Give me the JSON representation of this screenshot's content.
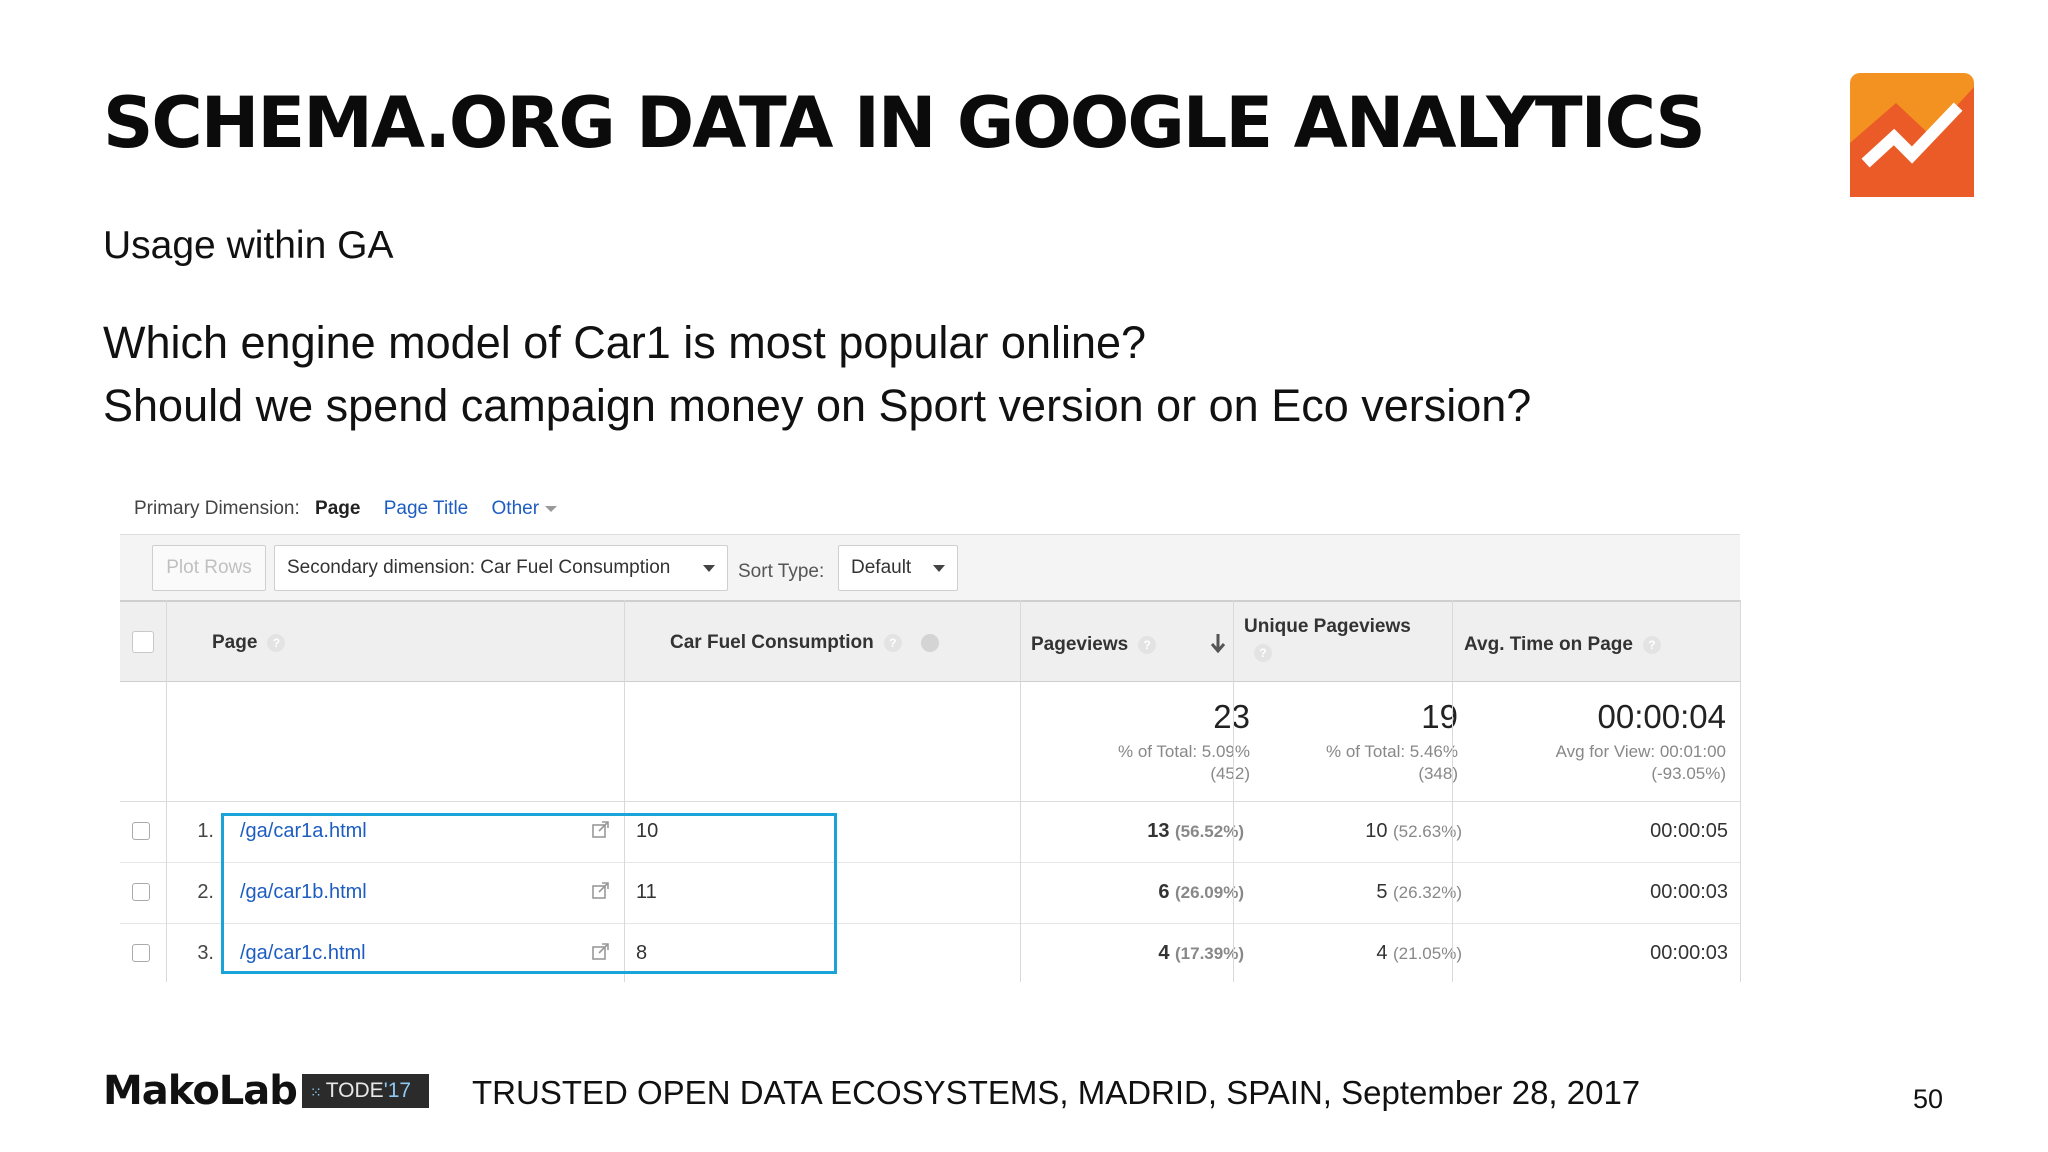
{
  "slide": {
    "title": "SCHEMA.ORG DATA IN GOOGLE ANALYTICS",
    "subtitle": "Usage within GA",
    "question_1": "Which engine model of Car1 is most popular online?",
    "question_2": "Should we spend campaign money on Sport version or on Eco version?",
    "colors": {
      "logo_orange": "#f39221",
      "logo_red": "#ea5b27",
      "highlight": "#1aa3d8",
      "link": "#1d5dc1"
    }
  },
  "ga": {
    "primary_dimension": {
      "label": "Primary Dimension:",
      "active": "Page",
      "options": [
        "Page Title",
        "Other"
      ]
    },
    "toolbar": {
      "plot_rows": "Plot Rows",
      "secondary_dimension": "Secondary dimension: Car Fuel Consumption",
      "sort_label": "Sort Type:",
      "sort_value": "Default"
    },
    "headers": {
      "page": "Page",
      "fuel": "Car Fuel Consumption",
      "pageviews": "Pageviews",
      "unique": "Unique Pageviews",
      "avg_time": "Avg. Time on Page",
      "help_icon": "?"
    },
    "totals": {
      "pageviews": {
        "value": "23",
        "line1": "% of Total: 5.09%",
        "line2": "(452)"
      },
      "unique": {
        "value": "19",
        "line1": "% of Total: 5.46%",
        "line2": "(348)"
      },
      "avg_time": {
        "value": "00:00:04",
        "line1": "Avg for View: 00:01:00",
        "line2": "(-93.05%)"
      }
    },
    "rows": [
      {
        "index": "1.",
        "page": "/ga/car1a.html",
        "fuel": "10",
        "pageviews": "13",
        "pageviews_pct": "(56.52%)",
        "unique": "10",
        "unique_pct": "(52.63%)",
        "avg_time": "00:00:05"
      },
      {
        "index": "2.",
        "page": "/ga/car1b.html",
        "fuel": "11",
        "pageviews": "6",
        "pageviews_pct": "(26.09%)",
        "unique": "5",
        "unique_pct": "(26.32%)",
        "avg_time": "00:00:03"
      },
      {
        "index": "3.",
        "page": "/ga/car1c.html",
        "fuel": "8",
        "pageviews": "4",
        "pageviews_pct": "(17.39%)",
        "unique": "4",
        "unique_pct": "(21.05%)",
        "avg_time": "00:00:03"
      }
    ]
  },
  "footer": {
    "brand": "MakoLab",
    "event_badge": "TODE",
    "event_badge_year": "'17",
    "text": "TRUSTED OPEN DATA ECOSYSTEMS, MADRID, SPAIN, September 28, 2017",
    "page_number": "50"
  }
}
